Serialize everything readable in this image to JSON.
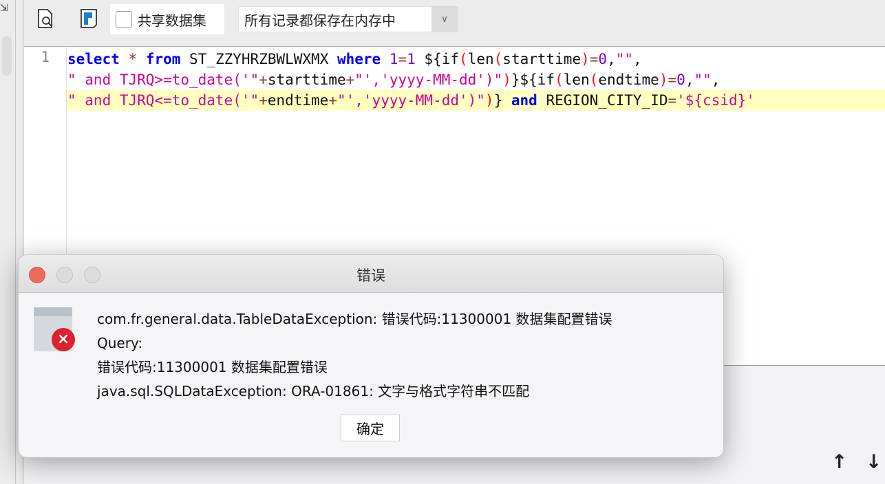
{
  "toolbar": {
    "preview_icon": "preview-icon",
    "save_icon": "save-icon",
    "share_label": "共享数据集",
    "storage_select": "所有记录都保存在内存中"
  },
  "editor": {
    "line_numbers": [
      "1"
    ],
    "colors": {
      "kw": "#0000ff",
      "str": "#d4008f",
      "num": "#7a00d0",
      "paren": "#ff1010",
      "op": "#8a3a3a",
      "plain": "#111111"
    },
    "lines": [
      {
        "highlight": false,
        "tokens": [
          [
            "select",
            "kw"
          ],
          [
            " ",
            "plain"
          ],
          [
            "*",
            "op"
          ],
          [
            " ",
            "plain"
          ],
          [
            "from",
            "kw"
          ],
          [
            " ST_ZZYHRZBWLWXMX ",
            "plain"
          ],
          [
            "where",
            "kw"
          ],
          [
            " ",
            "plain"
          ],
          [
            "1",
            "num"
          ],
          [
            "=",
            "op"
          ],
          [
            "1",
            "num"
          ],
          [
            " ${if",
            "plain"
          ],
          [
            "(",
            "paren"
          ],
          [
            "len",
            "plain"
          ],
          [
            "(",
            "paren"
          ],
          [
            "starttime",
            "plain"
          ],
          [
            ")",
            "paren"
          ],
          [
            "=",
            "op"
          ],
          [
            "0",
            "num"
          ],
          [
            ",",
            "plain"
          ],
          [
            "\"\"",
            "str"
          ],
          [
            ",",
            "plain"
          ]
        ]
      },
      {
        "highlight": false,
        "tokens": [
          [
            "\" and TJRQ>=to_date('\"",
            "str"
          ],
          [
            "+",
            "op"
          ],
          [
            "starttime",
            "plain"
          ],
          [
            "+",
            "op"
          ],
          [
            "\"','yyyy-MM-dd')\"",
            "str"
          ],
          [
            ")",
            "paren"
          ],
          [
            "}${if",
            "plain"
          ],
          [
            "(",
            "paren"
          ],
          [
            "len",
            "plain"
          ],
          [
            "(",
            "paren"
          ],
          [
            "endtime",
            "plain"
          ],
          [
            ")",
            "paren"
          ],
          [
            "=",
            "op"
          ],
          [
            "0",
            "num"
          ],
          [
            ",",
            "plain"
          ],
          [
            "\"\"",
            "str"
          ],
          [
            ",",
            "plain"
          ]
        ]
      },
      {
        "highlight": true,
        "tokens": [
          [
            "\" and TJRQ<=to_date('\"",
            "str"
          ],
          [
            "+",
            "op"
          ],
          [
            "endtime",
            "plain"
          ],
          [
            "+",
            "op"
          ],
          [
            "\"','yyyy-MM-dd')\"",
            "str"
          ],
          [
            ")",
            "paren"
          ],
          [
            "} ",
            "plain"
          ],
          [
            "and",
            "kw"
          ],
          [
            " REGION_CITY_ID",
            "plain"
          ],
          [
            "=",
            "op"
          ],
          [
            "'${csid}'",
            "str"
          ]
        ]
      }
    ]
  },
  "dialog": {
    "title": "错误",
    "icon": "error-icon",
    "messages": [
      "com.fr.general.data.TableDataException: 错误代码:11300001 数据集配置错误",
      "Query:",
      "错误代码:11300001 数据集配置错误",
      "java.sql.SQLDataException: ORA-01861: 文字与格式字符串不匹配"
    ],
    "ok_label": "确定"
  },
  "bottom": {
    "up": "↑",
    "down": "↓"
  }
}
